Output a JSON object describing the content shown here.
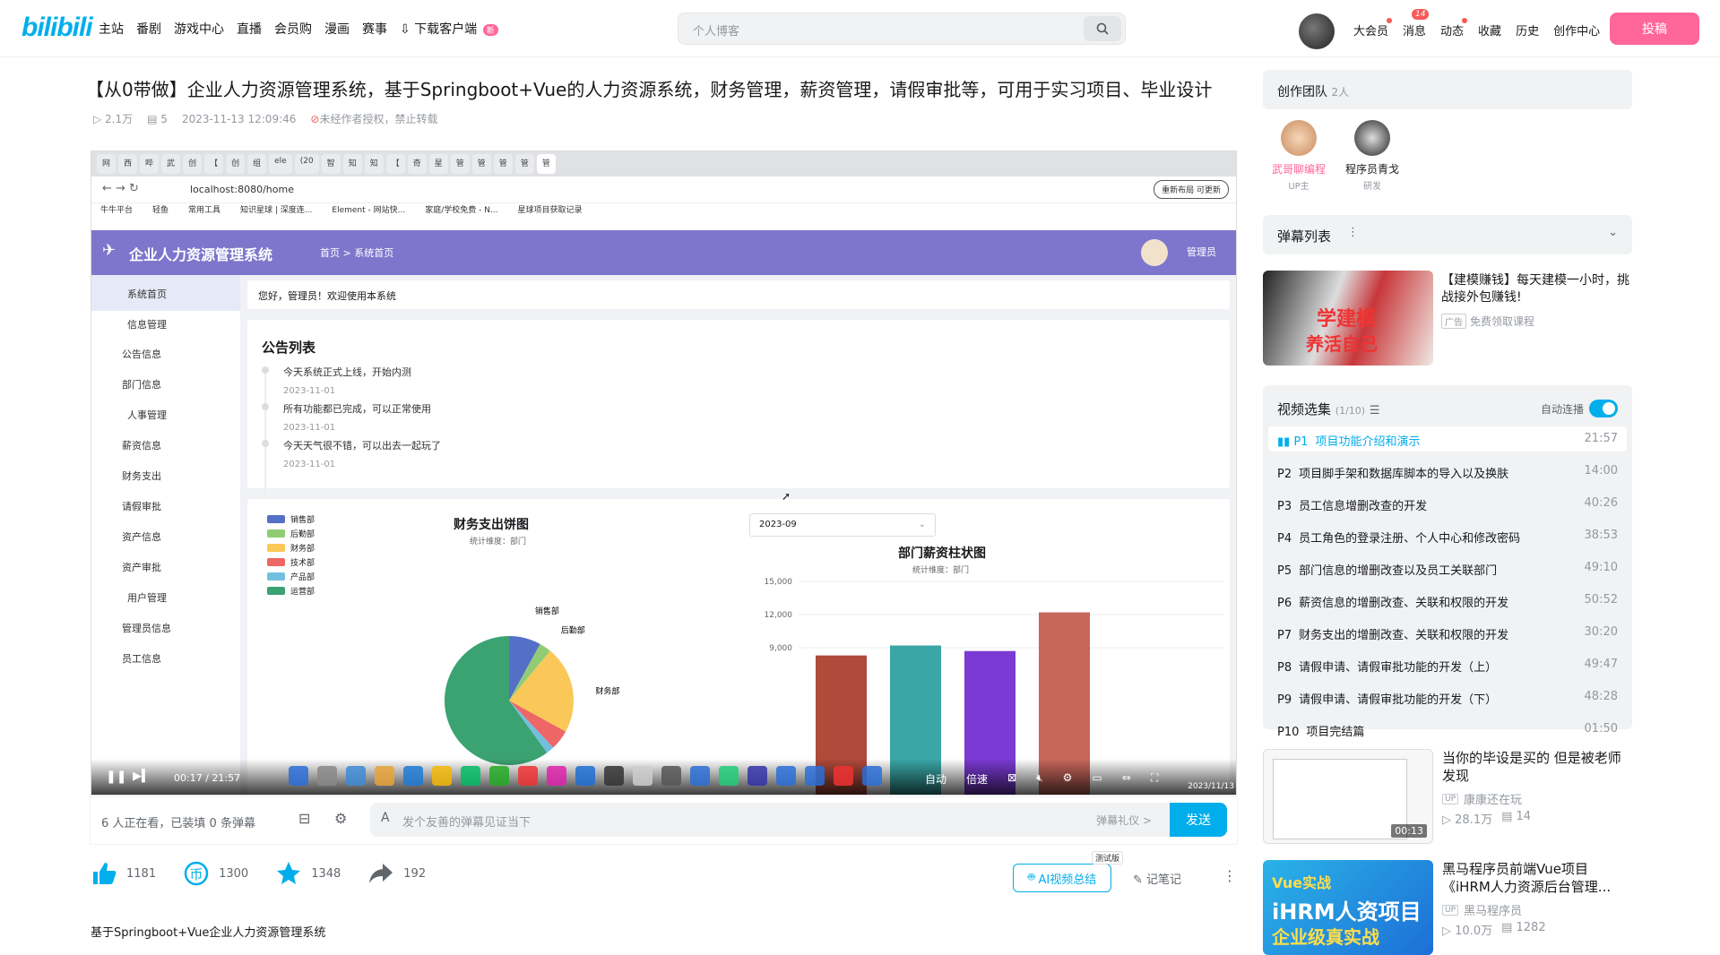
{
  "header": {
    "logo": "bilibili",
    "nav": [
      "主站",
      "番剧",
      "游戏中心",
      "直播",
      "会员购",
      "漫画",
      "赛事",
      "下载客户端"
    ],
    "download_badge": "新",
    "search_placeholder": "个人博客",
    "right_nav": [
      "大会员",
      "消息",
      "动态",
      "收藏",
      "历史",
      "创作中心"
    ],
    "message_count": "14",
    "upload": "投稿"
  },
  "video": {
    "title": "【从0带做】企业人力资源管理系统，基于Springboot+Vue的人力资源系统，财务管理，薪资管理，请假审批等，可用于实习项目、毕业设计",
    "views": "2.1万",
    "danmaku": "5",
    "date": "2023-11-13 12:09:46",
    "copyright": "未经作者授权，禁止转载"
  },
  "browser": {
    "tabs": [
      "网",
      "西",
      "哔",
      "武",
      "创",
      "【",
      "创",
      "组",
      "ele",
      "(20",
      "智",
      "知",
      "知",
      "【",
      "奇",
      "星",
      "管",
      "管",
      "管",
      "管",
      "管"
    ],
    "url": "localhost:8080/home",
    "bookmarks": [
      "牛牛平台",
      "轻鱼",
      "常用工具",
      "知识星球 | 深度连...",
      "Element - 网站快...",
      "家庭/学校免费 - N...",
      "星球项目获取记录"
    ],
    "overlay": "重新布局 可更新"
  },
  "app": {
    "title": "企业人力资源管理系统",
    "breadcrumb_home": "首页",
    "breadcrumb_current": "系统首页",
    "admin": "管理员",
    "welcome": "您好，管理员！欢迎使用本系统",
    "sidebar": [
      {
        "label": "系统首页",
        "group": true,
        "active": true
      },
      {
        "label": "信息管理",
        "group": true
      },
      {
        "label": "公告信息"
      },
      {
        "label": "部门信息"
      },
      {
        "label": "人事管理",
        "group": true
      },
      {
        "label": "薪资信息"
      },
      {
        "label": "财务支出"
      },
      {
        "label": "请假审批"
      },
      {
        "label": "资产信息"
      },
      {
        "label": "资产审批"
      },
      {
        "label": "用户管理",
        "group": true
      },
      {
        "label": "管理员信息"
      },
      {
        "label": "员工信息"
      }
    ],
    "announcements_title": "公告列表",
    "announcements": [
      {
        "text": "今天系统正式上线，开始内测",
        "date": "2023-11-01"
      },
      {
        "text": "所有功能都已完成，可以正常使用",
        "date": "2023-11-01"
      },
      {
        "text": "今天天气很不错，可以出去一起玩了",
        "date": "2023-11-01"
      }
    ]
  },
  "chart_data": [
    {
      "type": "pie",
      "title": "财务支出饼图",
      "subtitle": "统计维度：部门",
      "legend": [
        "销售部",
        "后勤部",
        "财务部",
        "技术部",
        "产品部",
        "运营部"
      ],
      "colors": [
        "#5470c6",
        "#91cc75",
        "#fac858",
        "#ee6666",
        "#73c0de",
        "#3ba272"
      ],
      "values": [
        8,
        3,
        22,
        5,
        2,
        60
      ]
    },
    {
      "type": "bar",
      "title": "部门薪资柱状图",
      "subtitle": "统计维度：部门",
      "month": "2023-09",
      "yticks": [
        "15,000",
        "12,000",
        "9,000"
      ],
      "ylim": [
        0,
        15000
      ],
      "values": [
        8300,
        9200,
        8700,
        12200
      ],
      "colors": [
        "#b04a3a",
        "#3aa6a6",
        "#7a3ad3",
        "#c7665a"
      ]
    }
  ],
  "player": {
    "time": "00:17 / 21:57",
    "auto": "自动",
    "speed": "倍速",
    "clock": "2023/11/13"
  },
  "danmaku_bar": {
    "viewers": "6 人正在看，已装填 0 条弹幕",
    "placeholder": "发个友善的弹幕见证当下",
    "etiquette": "弹幕礼仪 >",
    "send": "发送"
  },
  "actions": {
    "like": "1181",
    "coin": "1300",
    "fav": "1348",
    "share": "192",
    "ai_summary": "AI视频总结",
    "beta": "测试版",
    "notes": "记笔记",
    "desc": "基于Springboot+Vue企业人力资源管理系统"
  },
  "sidebar_right": {
    "team_title": "创作团队",
    "team_count": "2人",
    "members": [
      {
        "name": "武哥聊编程",
        "role": "UP主",
        "color": "#ff6699"
      },
      {
        "name": "程序员青戈",
        "role": "研发",
        "color": "#18191c"
      }
    ],
    "danmaku_list": "弹幕列表",
    "ad": {
      "title": "【建模赚钱】每天建模一小时，挑战接外包赚钱!",
      "tag": "广告",
      "sub": "免费领取课程",
      "overlay1": "学建模",
      "overlay2": "养活自己"
    },
    "episodes_title": "视频选集",
    "episodes_count": "(1/10)",
    "autoplay": "自动连播",
    "episodes": [
      {
        "p": "P1",
        "title": "项目功能介绍和演示",
        "dur": "21:57"
      },
      {
        "p": "P2",
        "title": "项目脚手架和数据库脚本的导入以及换肤",
        "dur": "14:00"
      },
      {
        "p": "P3",
        "title": "员工信息增删改查的开发",
        "dur": "40:26"
      },
      {
        "p": "P4",
        "title": "员工角色的登录注册、个人中心和修改密码",
        "dur": "38:53"
      },
      {
        "p": "P5",
        "title": "部门信息的增删改查以及员工关联部门",
        "dur": "49:10"
      },
      {
        "p": "P6",
        "title": "薪资信息的增删改查、关联和权限的开发",
        "dur": "50:52"
      },
      {
        "p": "P7",
        "title": "财务支出的增删改查、关联和权限的开发",
        "dur": "30:20"
      },
      {
        "p": "P8",
        "title": "请假申请、请假审批功能的开发（上）",
        "dur": "49:47"
      },
      {
        "p": "P9",
        "title": "请假申请、请假审批功能的开发（下）",
        "dur": "48:28"
      },
      {
        "p": "P10",
        "title": "项目完结篇",
        "dur": "01:50"
      }
    ],
    "recs": [
      {
        "title": "当你的毕设是买的 但是被老师发现",
        "up": "康康还在玩",
        "views": "28.1万",
        "dm": "14",
        "dur": "00:13"
      },
      {
        "title": "黑马程序员前端Vue项目《iHRM人力资源后台管理...",
        "up": "黑马程序员",
        "views": "10.0万",
        "dm": "1282",
        "thumb_text": "Vue实战",
        "thumb_text2": "iHRM人资项目",
        "thumb_text3": "企业级真实战"
      }
    ]
  }
}
